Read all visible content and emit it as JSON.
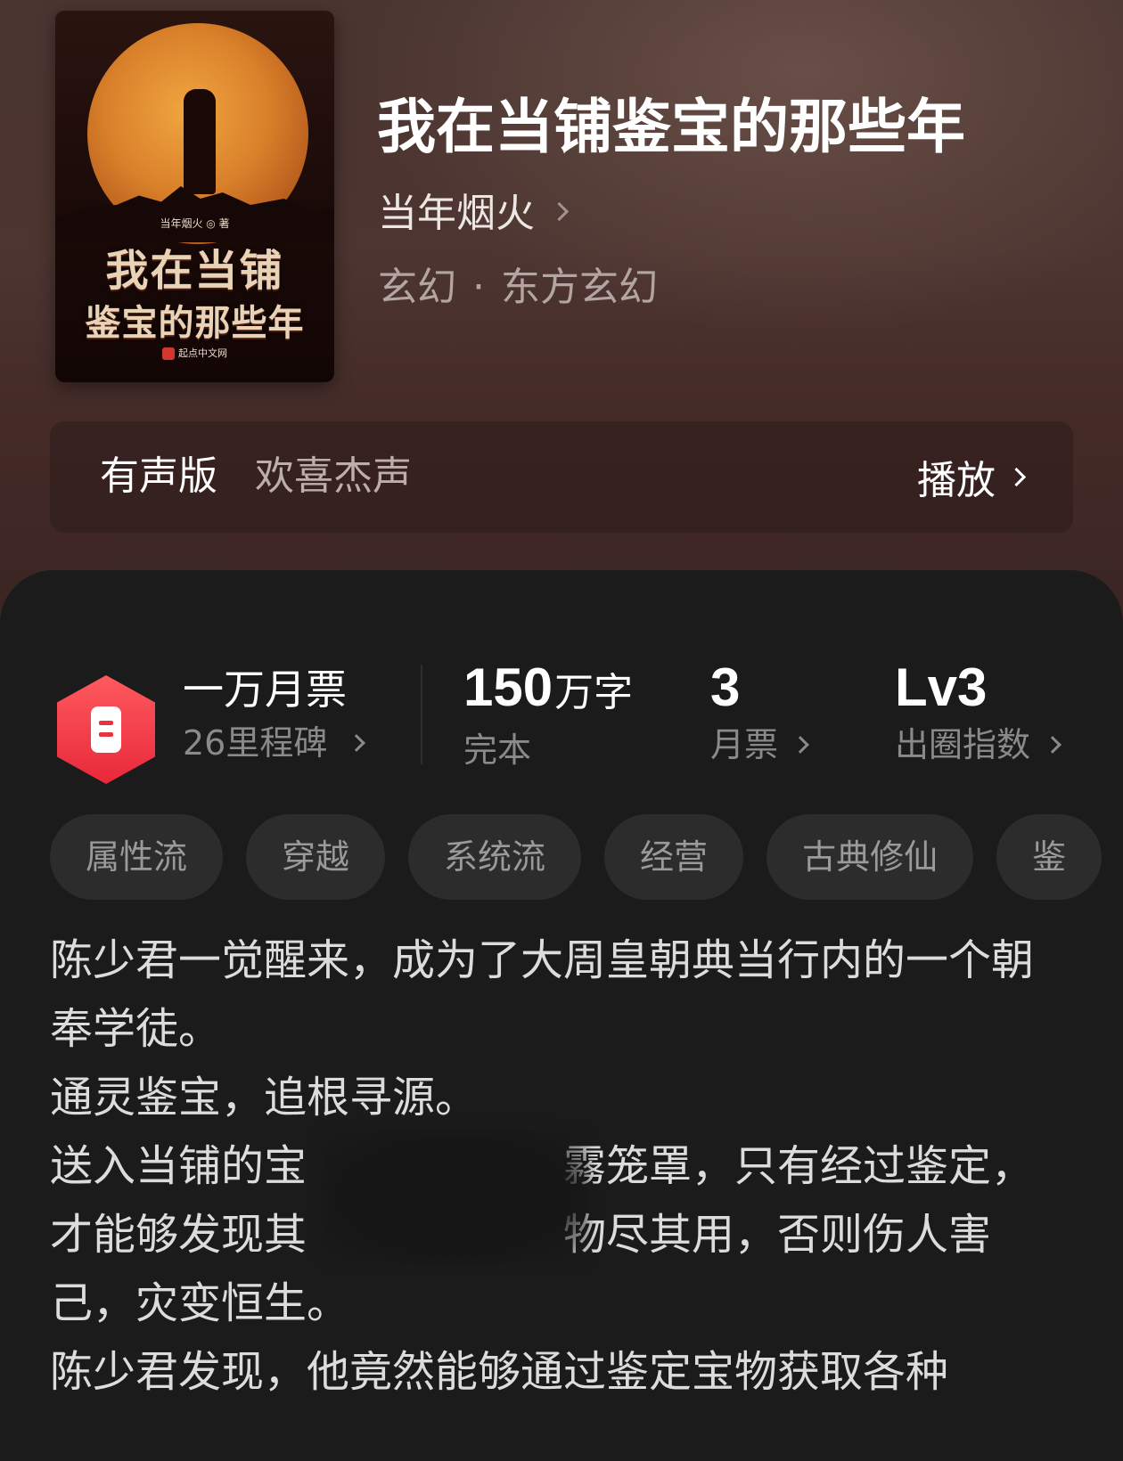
{
  "book": {
    "title": "我在当铺鉴宝的那些年",
    "author": "当年烟火",
    "genre": "玄幻",
    "subgenre": "东方玄幻",
    "genre_separator": "·"
  },
  "cover": {
    "title_line1": "我在当铺",
    "title_line2": "鉴宝的那些年",
    "author_credit": "当年烟火 ◎ 著",
    "publisher": "起点中文网"
  },
  "audio": {
    "label": "有声版",
    "narrator": "欢喜杰声",
    "play_label": "播放"
  },
  "stats": {
    "milestone_title": "一万月票",
    "milestone_sub": "26里程碑",
    "words_value": "150",
    "words_unit": "万字",
    "words_label": "完本",
    "tickets_value": "3",
    "tickets_label": "月票",
    "level_value": "Lv3",
    "level_label": "出圈指数"
  },
  "tags": [
    "属性流",
    "穿越",
    "系统流",
    "经营",
    "古典修仙",
    "鉴"
  ],
  "description": {
    "p1": "陈少君一觉醒来，成为了大周皇朝典当行内的一个朝奉学徒。",
    "p2": "通灵鉴宝，追根寻源。",
    "p3": "送入当铺的宝　　　　　　霧笼罩，只有经过鉴定，才能够发现其　　　　　　物尽其用，否则伤人害己，灾变恒生。",
    "p4": "陈少君发现，他竟然能够通过鉴定宝物获取各种"
  },
  "colors": {
    "hero_background": "#4a3531",
    "panel_background": "#1b1b1b",
    "badge_red": "#ea3240",
    "tag_background": "#2c2c2c",
    "muted_text": "#8a8a8a"
  }
}
